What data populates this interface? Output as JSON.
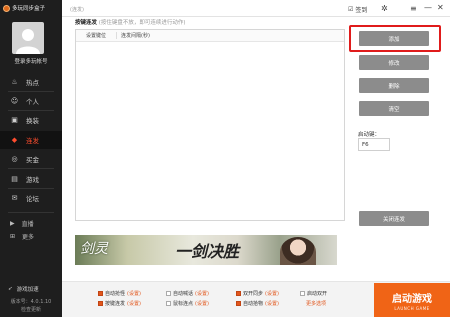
{
  "app": {
    "name": "多玩同步盒子"
  },
  "sidebar": {
    "login_label": "登录多玩帐号",
    "nav": [
      {
        "label": "热点",
        "icon": "flame-icon",
        "glyph": "♨"
      },
      {
        "label": "个人",
        "icon": "user-icon",
        "glyph": "☺"
      },
      {
        "label": "换装",
        "icon": "shirt-icon",
        "glyph": "▣"
      },
      {
        "label": "连发",
        "icon": "burst-icon",
        "glyph": "◆"
      },
      {
        "label": "买金",
        "icon": "coin-icon",
        "glyph": "◎"
      },
      {
        "label": "游戏",
        "icon": "gamepad-icon",
        "glyph": "▤"
      },
      {
        "label": "论坛",
        "icon": "chat-icon",
        "glyph": "✉"
      }
    ],
    "extra": [
      {
        "label": "直播",
        "icon": "live-icon",
        "glyph": "▶"
      },
      {
        "label": "更多",
        "icon": "grid-icon",
        "glyph": "⊞"
      }
    ],
    "accelerate_label": "游戏加速",
    "version": "版本号：4.0.1.10",
    "check_update": "检查更新"
  },
  "topbar": {
    "breadcrumb": "(连发)",
    "skin_label": "签到",
    "icons": {
      "skin": "skin-icon",
      "settings": "settings-icon",
      "menu": "menu-icon",
      "minimize": "minimize-icon",
      "close": "close-icon"
    }
  },
  "main": {
    "title": "按键连发",
    "hint": "(按住键盘不放，即可连续进行动作)",
    "columns": [
      "设置键位",
      "连发间隔(秒)"
    ],
    "rows": []
  },
  "actions": {
    "add": "添加",
    "edit": "修改",
    "delete": "删除",
    "clear": "清空",
    "hotkey_label": "启动键：",
    "hotkey_value": "F6",
    "toggle": "关闭连发"
  },
  "banner": {
    "logo_left": "剑灵",
    "logo_right": "一剑决胜"
  },
  "bottom": {
    "options": [
      {
        "label": "自动抢怪",
        "set": "(设置)",
        "checked": true
      },
      {
        "label": "自动喊话",
        "set": "(设置)",
        "checked": false
      },
      {
        "label": "双开同步",
        "set": "(设置)",
        "checked": true
      },
      {
        "label": "启动双开",
        "set": "",
        "checked": false
      },
      {
        "label": "按键连发",
        "set": "(设置)",
        "checked": true
      },
      {
        "label": "鼠标连点",
        "set": "(设置)",
        "checked": false
      },
      {
        "label": "自动拾物",
        "set": "(设置)",
        "checked": true
      },
      {
        "label": "更多选项",
        "set": "",
        "checked": null
      }
    ],
    "start_label": "启动游戏",
    "start_sub": "LAUNCH GAME"
  },
  "colors": {
    "accent": "#f06416",
    "active_nav": "#ff4d2e",
    "sidebar_bg": "#1e1e1e",
    "highlight": "#e01b1b"
  }
}
